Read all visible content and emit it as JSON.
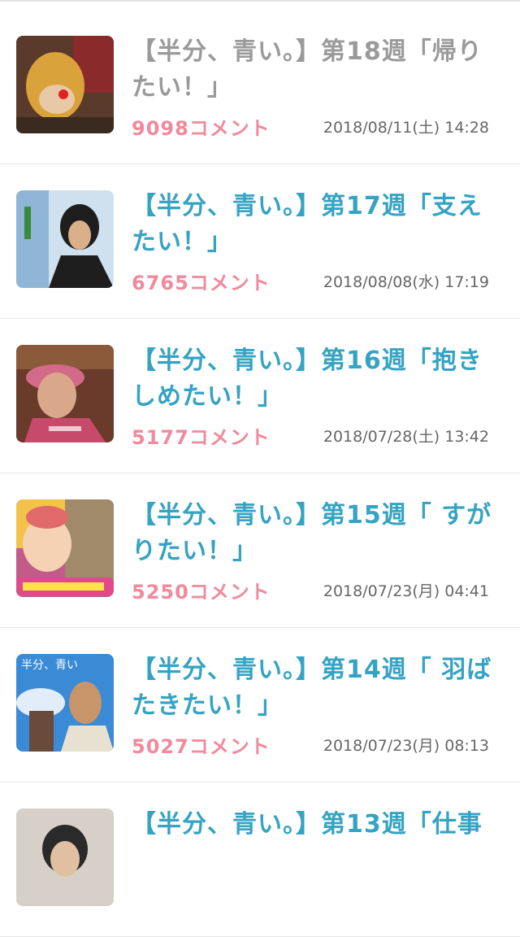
{
  "articles": [
    {
      "title": "【半分、青い。】第18週「帰りたい！」",
      "comments": "9098コメント",
      "date": "2018/08/11(土) 14:28",
      "visited": true,
      "thumb": {
        "bg": "#5a3a2a",
        "accent": "#d9a23a",
        "figure": "#e7c9a8"
      }
    },
    {
      "title": "【半分、青い。】第17週「支えたい！」",
      "comments": "6765コメント",
      "date": "2018/08/08(水) 17:19",
      "visited": false,
      "thumb": {
        "bg": "#8fb6d6",
        "accent": "#2a2a2a",
        "figure": "#1e1e1e"
      }
    },
    {
      "title": "【半分、青い。】第16週「抱きしめたい！」",
      "comments": "5177コメント",
      "date": "2018/07/28(土) 13:42",
      "visited": false,
      "thumb": {
        "bg": "#6a3a2a",
        "accent": "#d46a8a",
        "figure": "#d9a88a"
      }
    },
    {
      "title": "【半分、青い。】第15週「 すがりたい！」",
      "comments": "5250コメント",
      "date": "2018/07/23(月) 04:41",
      "visited": false,
      "thumb": {
        "bg": "#c25a8a",
        "accent": "#f2c24a",
        "figure": "#f6d2b4"
      }
    },
    {
      "title": "【半分、青い。】第14週「 羽ばたきたい！」",
      "comments": "5027コメント",
      "date": "2018/07/23(月) 08:13",
      "visited": false,
      "thumb": {
        "bg": "#3a8ad6",
        "accent": "#6a4a3a",
        "figure": "#c8946a"
      }
    },
    {
      "title": "【半分、青い。】第13週「仕事",
      "comments": "",
      "date": "",
      "visited": false,
      "thumb": {
        "bg": "#d6d0c8",
        "accent": "#2a2a2a",
        "figure": "#e0c0a0"
      }
    }
  ]
}
